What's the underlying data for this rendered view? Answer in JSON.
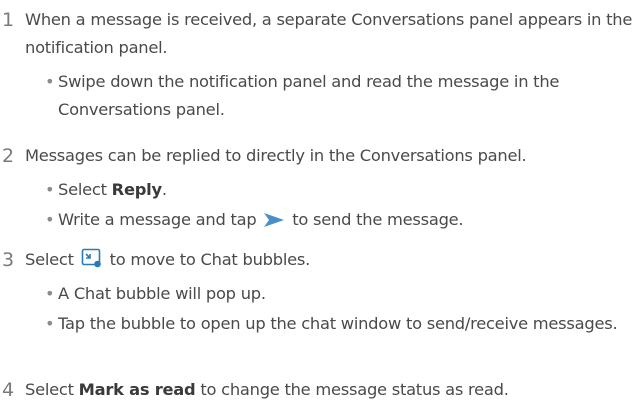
{
  "steps": [
    {
      "num": "1",
      "text": "When a message is received, a separate Conversations panel appears in the notification panel.",
      "bullets": [
        "Swipe down the notification panel and read the message in the Conversations panel."
      ]
    },
    {
      "num": "2",
      "text": "Messages can be replied to directly in the Conversations panel.",
      "bullets": {
        "b1_pre": "Select ",
        "b1_bold": "Reply",
        "b1_post": ".",
        "b2_pre": "Write a message and tap ",
        "b2_post": " to send the message."
      }
    },
    {
      "num": "3",
      "text_pre": "Select ",
      "text_post": " to move to Chat bubbles.",
      "bullets": [
        "A Chat bubble will pop up.",
        "Tap the bubble to open up the chat window to send/receive messages."
      ]
    },
    {
      "num": "4",
      "text_pre": "Select ",
      "text_bold": "Mark as read",
      "text_post": " to change the message status as read."
    }
  ],
  "bullet_glyph": "•",
  "icons": {
    "send": "send-arrow-icon",
    "chat_bubble": "chat-bubble-icon"
  },
  "colors": {
    "text": "#4a4a4a",
    "step_number": "#7a7a7a",
    "send_icon": "#4a90c8",
    "bubble_icon": "#2a7ab8"
  }
}
